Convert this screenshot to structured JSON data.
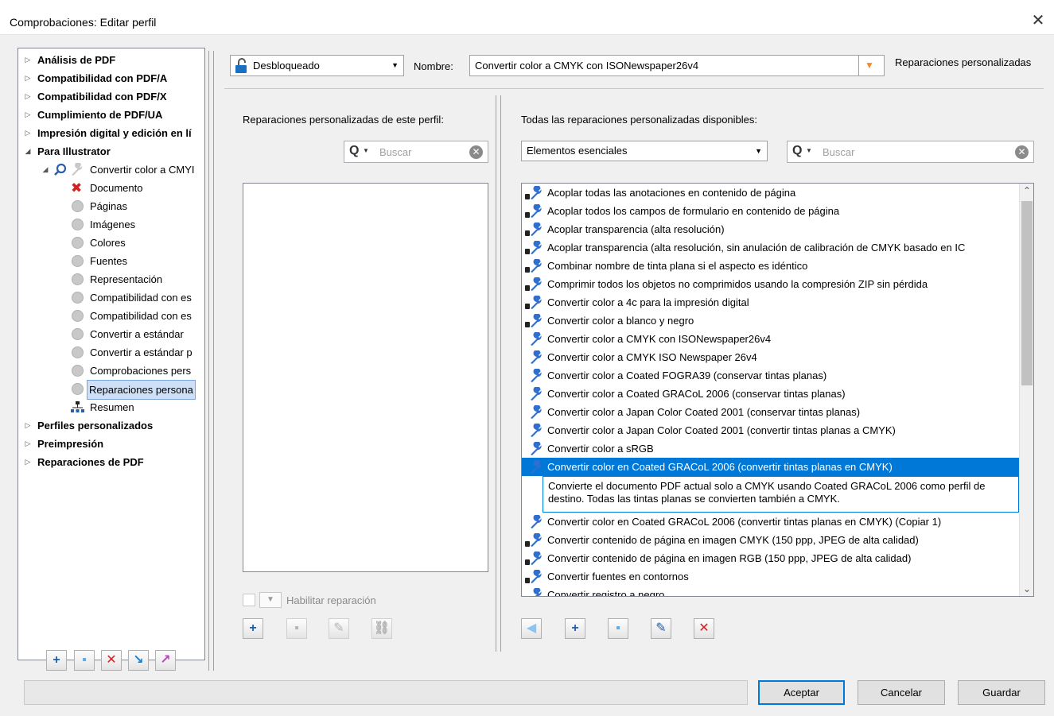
{
  "window": {
    "title": "Comprobaciones: Editar perfil"
  },
  "tree": {
    "items": [
      {
        "label": "Análisis de PDF"
      },
      {
        "label": "Compatibilidad con PDF/A"
      },
      {
        "label": "Compatibilidad con PDF/X"
      },
      {
        "label": "Cumplimiento de PDF/UA"
      },
      {
        "label": "Impresión digital y edición en lí"
      },
      {
        "label": "Para Illustrator"
      },
      {
        "label": "Convertir color a CMYI"
      },
      {
        "label": "Documento"
      },
      {
        "label": "Páginas"
      },
      {
        "label": "Imágenes"
      },
      {
        "label": "Colores"
      },
      {
        "label": "Fuentes"
      },
      {
        "label": "Representación"
      },
      {
        "label": "Compatibilidad con es"
      },
      {
        "label": "Compatibilidad con es"
      },
      {
        "label": "Convertir a estándar"
      },
      {
        "label": "Convertir a estándar p"
      },
      {
        "label": "Comprobaciones pers"
      },
      {
        "label": "Reparaciones persona"
      },
      {
        "label": "Resumen"
      },
      {
        "label": "Perfiles personalizados"
      },
      {
        "label": "Preimpresión"
      },
      {
        "label": "Reparaciones de PDF"
      }
    ]
  },
  "header": {
    "lock_value": "Desbloqueado",
    "name_label": "Nombre:",
    "name_value": "Convertir color a CMYK con ISONewspaper26v4",
    "section_title": "Reparaciones personalizadas"
  },
  "left_pane": {
    "title": "Reparaciones personalizadas de este perfil:",
    "search_placeholder": "Buscar",
    "enable_label": "Habilitar reparación"
  },
  "right_pane": {
    "title": "Todas las reparaciones personalizadas disponibles:",
    "category_value": "Elementos esenciales",
    "search_placeholder": "Buscar",
    "items": [
      {
        "label": "Acoplar todas las anotaciones en contenido de página",
        "locked": true
      },
      {
        "label": "Acoplar todos los campos de formulario en contenido de página",
        "locked": true
      },
      {
        "label": "Acoplar transparencia (alta resolución)",
        "locked": true
      },
      {
        "label": "Acoplar transparencia (alta resolución, sin anulación de calibración de CMYK basado en IC",
        "locked": true
      },
      {
        "label": "Combinar nombre de tinta plana si el aspecto es idéntico",
        "locked": true
      },
      {
        "label": "Comprimir todos los objetos no comprimidos usando la compresión ZIP sin pérdida",
        "locked": true
      },
      {
        "label": "Convertir color a 4c para la impresión digital",
        "locked": true
      },
      {
        "label": "Convertir color a blanco y negro",
        "locked": true
      },
      {
        "label": "Convertir color a CMYK con ISONewspaper26v4",
        "locked": false
      },
      {
        "label": "Convertir color a CMYK ISO Newspaper 26v4",
        "locked": false
      },
      {
        "label": "Convertir color a Coated FOGRA39 (conservar tintas planas)",
        "locked": false
      },
      {
        "label": "Convertir color a Coated GRACoL 2006 (conservar tintas planas)",
        "locked": false
      },
      {
        "label": "Convertir color a Japan Color Coated 2001 (conservar tintas planas)",
        "locked": false
      },
      {
        "label": "Convertir color a Japan Color Coated 2001 (convertir tintas planas a CMYK)",
        "locked": false
      },
      {
        "label": "Convertir color a sRGB",
        "locked": false
      },
      {
        "label": "Convertir color en Coated GRACoL 2006 (convertir tintas planas en CMYK)",
        "locked": false,
        "selected": true
      },
      {
        "label": "Convertir color en Coated GRACoL 2006 (convertir tintas planas en CMYK) (Copiar 1)",
        "locked": false
      },
      {
        "label": "Convertir contenido de página en imagen CMYK (150 ppp, JPEG de alta calidad)",
        "locked": true
      },
      {
        "label": "Convertir contenido de página en imagen RGB (150 ppp, JPEG de alta calidad)",
        "locked": true
      },
      {
        "label": "Convertir fuentes en contornos",
        "locked": true
      },
      {
        "label": "Convertir registro a negro",
        "locked": false
      }
    ],
    "selected_description": "Convierte el documento PDF actual solo a CMYK usando Coated GRACoL 2006 como perfil de destino. Todas las tintas planas se convierten también a CMYK."
  },
  "footer": {
    "ok_label": "Aceptar",
    "cancel_label": "Cancelar",
    "save_label": "Guardar"
  },
  "colors": {
    "selection": "#0078d7",
    "accent_orange": "#f28c28",
    "delete_red": "#d32020"
  }
}
